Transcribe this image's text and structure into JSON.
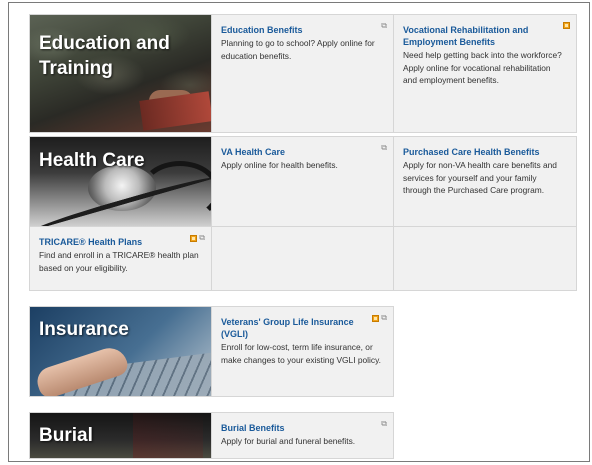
{
  "sections": {
    "education": {
      "title": "Education and Training",
      "title_line1": "Education and",
      "title_line2": "Training",
      "cards": [
        {
          "title": "Education Benefits",
          "description": "Planning to go to school? Apply online for education benefits.",
          "icons": [
            "external-link-icon"
          ]
        },
        {
          "title": "Vocational Rehabilitation and Employment Benefits",
          "description": "Need help getting back into the workforce? Apply online for vocational rehabilitation and employment benefits.",
          "icons": [
            "form-icon"
          ]
        }
      ]
    },
    "health": {
      "title": "Health Care",
      "cards": [
        {
          "title": "VA Health Care",
          "description": "Apply online for health benefits.",
          "icons": [
            "external-link-icon"
          ]
        },
        {
          "title": "Purchased Care Health Benefits",
          "description": "Apply for non-VA health care benefits and services for yourself and your family through the Purchased Care program.",
          "icons": []
        },
        {
          "title": "TRICARE® Health Plans",
          "description": "Find and enroll in a TRICARE® health plan based on your eligibility.",
          "icons": [
            "form-icon",
            "external-link-icon"
          ]
        }
      ]
    },
    "insurance": {
      "title": "Insurance",
      "cards": [
        {
          "title": "Veterans' Group Life Insurance (VGLI)",
          "description": "Enroll for low-cost, term life insurance, or make changes to your existing VGLI policy.",
          "icons": [
            "form-icon",
            "external-link-icon"
          ]
        }
      ]
    },
    "burial": {
      "title": "Burial",
      "cards": [
        {
          "title": "Burial Benefits",
          "description": "Apply for burial and funeral benefits.",
          "icons": [
            "external-link-icon"
          ]
        }
      ]
    }
  },
  "icon_glyphs": {
    "external_link": "⧉"
  },
  "colors": {
    "link": "#1a5a9a",
    "card_bg": "#f1f1f1",
    "form_icon": "#f2a31a"
  }
}
